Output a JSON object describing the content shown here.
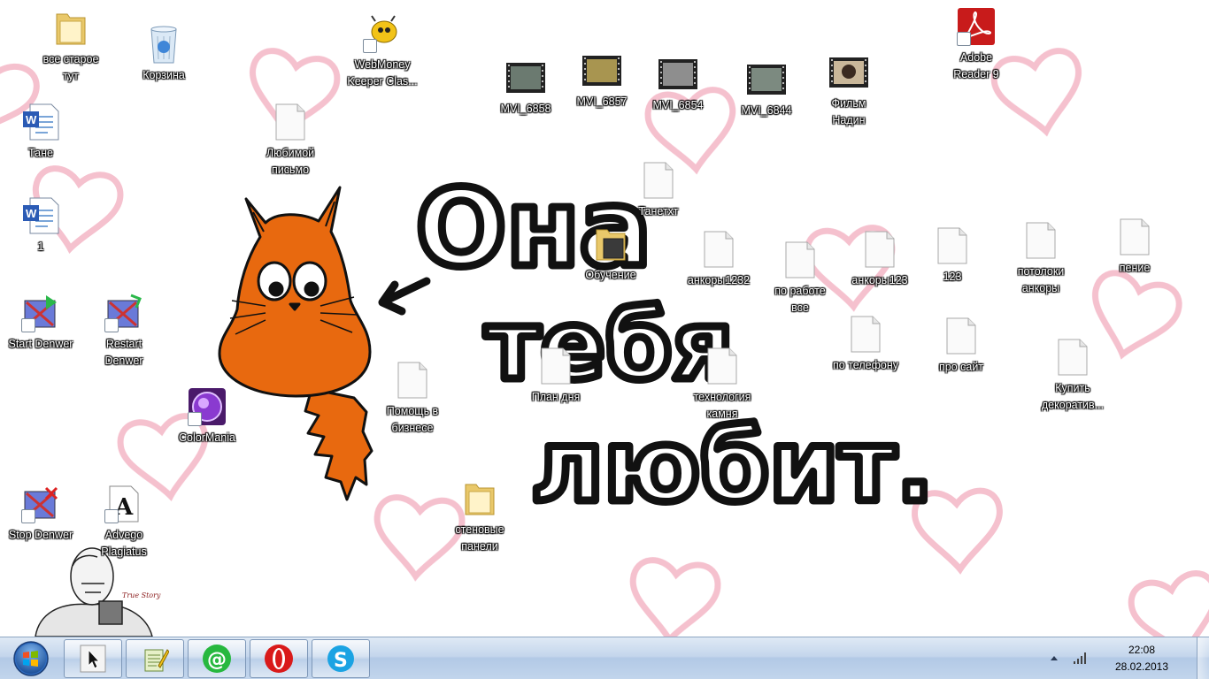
{
  "wallpaper": {
    "caption_line1": "Она",
    "caption_line2": "тебя",
    "caption_line3": "любит.",
    "meme_caption": "True Story"
  },
  "desktop_icons": [
    {
      "id": "vse-staroe",
      "label": "все старое\nтут",
      "icon": "folder-icon"
    },
    {
      "id": "korzina",
      "label": "Корзина",
      "icon": "recycle-bin-icon"
    },
    {
      "id": "webmoney",
      "label": "WebMoney\nKeeper Clas...",
      "icon": "webmoney-icon"
    },
    {
      "id": "mvi-6858",
      "label": "MVI_6858",
      "icon": "video-thumbnail-icon"
    },
    {
      "id": "mvi-6857",
      "label": "MVI_6857",
      "icon": "video-thumbnail-icon"
    },
    {
      "id": "mvi-6854",
      "label": "MVI_6854",
      "icon": "video-thumbnail-icon"
    },
    {
      "id": "mvi-6844",
      "label": "MVI_6844",
      "icon": "video-thumbnail-icon"
    },
    {
      "id": "film-nadin",
      "label": "Фильм\nНадин",
      "icon": "video-thumbnail-icon"
    },
    {
      "id": "adobe-reader",
      "label": "Adobe\nReader 9",
      "icon": "adobe-reader-icon"
    },
    {
      "id": "tane",
      "label": "Тане",
      "icon": "word-document-icon"
    },
    {
      "id": "lyubimoy",
      "label": "Любимой\nписьмо",
      "icon": "text-file-icon"
    },
    {
      "id": "tanetxt",
      "label": "Танетхт",
      "icon": "text-file-icon"
    },
    {
      "id": "one",
      "label": "1",
      "icon": "word-document-icon"
    },
    {
      "id": "obuchenie",
      "label": "Обучение",
      "icon": "folder-icon"
    },
    {
      "id": "ankory1232",
      "label": "анкоры1232",
      "icon": "text-file-icon"
    },
    {
      "id": "po-rabote",
      "label": "по работе\nвсе",
      "icon": "text-file-icon"
    },
    {
      "id": "ankory123",
      "label": "анкоры123",
      "icon": "text-file-icon"
    },
    {
      "id": "n123",
      "label": "123",
      "icon": "text-file-icon"
    },
    {
      "id": "potolki",
      "label": "потолоки\nанкоры",
      "icon": "text-file-icon"
    },
    {
      "id": "penie",
      "label": "пение",
      "icon": "text-file-icon"
    },
    {
      "id": "start-denwer",
      "label": "Start Denwer",
      "icon": "denwer-start-icon"
    },
    {
      "id": "restart-denwer",
      "label": "Restart\nDenwer",
      "icon": "denwer-restart-icon"
    },
    {
      "id": "po-telefonu",
      "label": "по телефону",
      "icon": "text-file-icon"
    },
    {
      "id": "pro-sait",
      "label": "про сайт",
      "icon": "text-file-icon"
    },
    {
      "id": "plan-dnya",
      "label": "План дня",
      "icon": "text-file-icon"
    },
    {
      "id": "tehnologiya",
      "label": "технология\nкамня",
      "icon": "text-file-icon"
    },
    {
      "id": "kupit",
      "label": "Купить\nдекоратив...",
      "icon": "text-file-icon"
    },
    {
      "id": "pomosh",
      "label": "Помощь в\nбизнесе",
      "icon": "text-file-icon"
    },
    {
      "id": "colormania",
      "label": "ColorMania",
      "icon": "colormania-icon"
    },
    {
      "id": "stenovye",
      "label": "стеновые\nпанели",
      "icon": "folder-icon"
    },
    {
      "id": "stop-denwer",
      "label": "Stop Denwer",
      "icon": "denwer-stop-icon"
    },
    {
      "id": "advego",
      "label": "Advego\nPlagiatus",
      "icon": "advego-icon"
    }
  ],
  "taskbar": {
    "start_icon": "windows-start-icon",
    "pinned": [
      {
        "id": "cursor-app",
        "icon": "mouse-cursor-icon"
      },
      {
        "id": "notepad-app",
        "icon": "notepad-icon"
      },
      {
        "id": "mail-agent",
        "icon": "mail-agent-icon"
      },
      {
        "id": "opera",
        "icon": "opera-icon"
      },
      {
        "id": "skype",
        "icon": "skype-icon"
      }
    ],
    "clock_time": "22:08",
    "clock_date": "28.02.2013"
  }
}
